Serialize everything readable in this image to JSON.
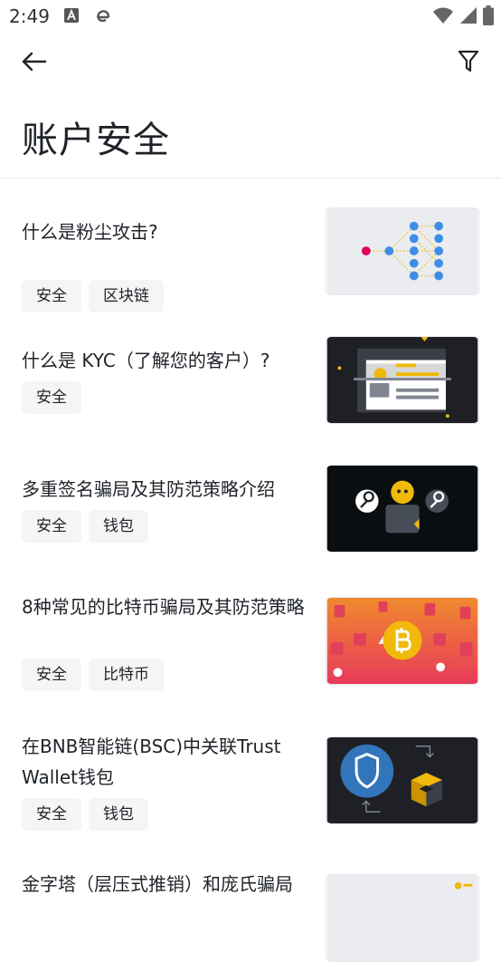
{
  "status_bar": {
    "time": "2:49"
  },
  "page": {
    "title": "账户安全"
  },
  "articles": [
    {
      "title": "什么是粉尘攻击?",
      "tags": [
        "安全",
        "区块链"
      ]
    },
    {
      "title": "什么是 KYC（了解您的客户）?",
      "tags": [
        "安全"
      ]
    },
    {
      "title": "多重签名骗局及其防范策略介绍",
      "tags": [
        "安全",
        "钱包"
      ]
    },
    {
      "title": "8种常见的比特币骗局及其防范策略",
      "tags": [
        "安全",
        "比特币"
      ]
    },
    {
      "title": "在BNB智能链(BSC)中关联Trust Wallet钱包",
      "tags": [
        "安全",
        "钱包"
      ]
    },
    {
      "title": "金字塔（层压式推销）和庞氏骗局",
      "tags": []
    }
  ],
  "icons": {
    "back": "arrow-left-icon",
    "filter": "filter-icon",
    "wifi": "wifi-icon",
    "signal": "signal-icon",
    "battery": "battery-icon"
  },
  "colors": {
    "text": "#1e2329",
    "tag_bg": "#f5f5f5",
    "brand_yellow": "#f0b90b"
  }
}
